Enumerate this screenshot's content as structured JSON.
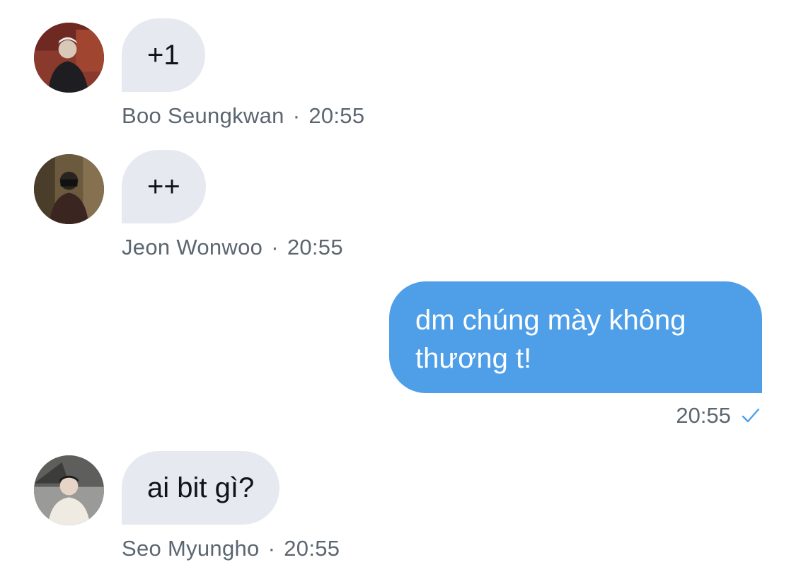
{
  "messages": [
    {
      "direction": "incoming",
      "text": "+1",
      "sender": "Boo Seungkwan",
      "separator": "·",
      "time": "20:55",
      "avatar": "avatar-boo-seungkwan"
    },
    {
      "direction": "incoming",
      "text": "++",
      "sender": "Jeon Wonwoo",
      "separator": "·",
      "time": "20:55",
      "avatar": "avatar-jeon-wonwoo"
    },
    {
      "direction": "outgoing",
      "text": "dm chúng mày không thương t!",
      "time": "20:55",
      "status_icon": "check-icon"
    },
    {
      "direction": "incoming",
      "text": "ai bit gì?",
      "sender": "Seo Myungho",
      "separator": "·",
      "time": "20:55",
      "avatar": "avatar-seo-myungho"
    }
  ],
  "colors": {
    "incoming_bubble": "#e6e9ef",
    "outgoing_bubble": "#4e9fe8",
    "meta_text": "#5b6670",
    "check": "#4e9fe8"
  }
}
